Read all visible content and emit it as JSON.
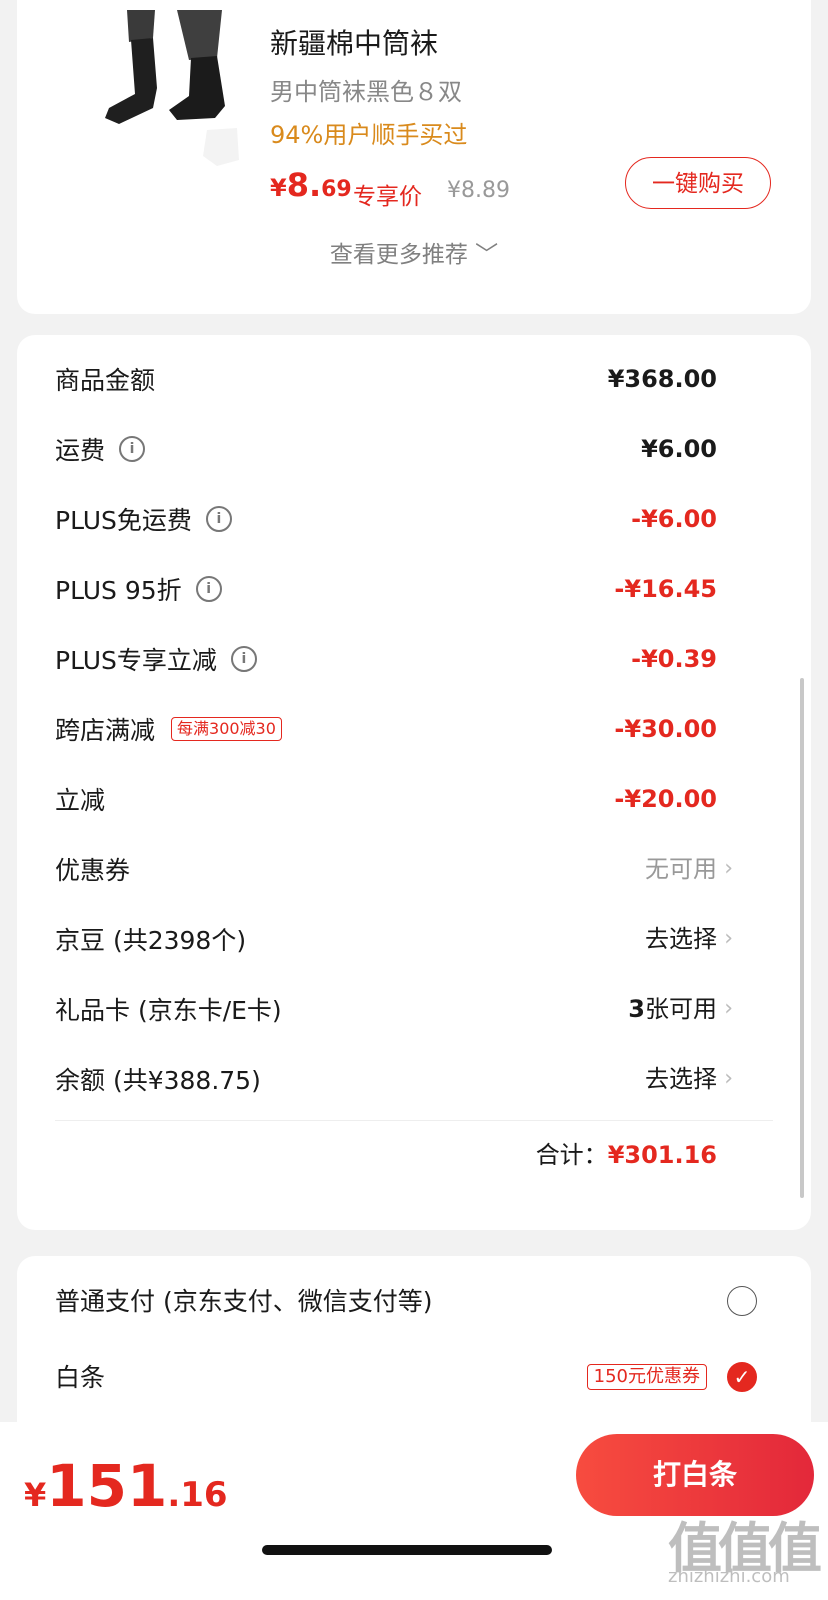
{
  "recommendation": {
    "product_name": "新疆棉中筒袜",
    "spec": "男中筒袜黑色８双",
    "hint": "94%用户顺手买过",
    "price_currency": "¥",
    "price_int": "8.",
    "price_dec": "69",
    "price_tag": "专享价",
    "original_price": "¥8.89",
    "buy_button": "一键购买",
    "more_label": "查看更多推荐 ﹀"
  },
  "costs": {
    "rows": [
      {
        "label": "商品金额",
        "value": "¥368.00"
      },
      {
        "label": "运费",
        "value": "¥6.00"
      },
      {
        "label": "PLUS免运费",
        "value": "-¥6.00"
      },
      {
        "label": "PLUS 95折",
        "value": "-¥16.45"
      },
      {
        "label": "PLUS专享立减",
        "value": "-¥0.39"
      },
      {
        "label": "跨店满减",
        "badge": "每满300减30",
        "value": "-¥30.00"
      },
      {
        "label": "立减",
        "value": "-¥20.00"
      },
      {
        "label": "优惠券",
        "value": "无可用"
      },
      {
        "label": "京豆 (共2398个)",
        "value": "去选择"
      },
      {
        "label": "礼品卡 (京东卡/E卡)",
        "value_num": "3",
        "value": "张可用"
      },
      {
        "label": "余额 (共¥388.75)",
        "value": "去选择"
      }
    ],
    "total_label": "合计：",
    "total_value": "¥301.16"
  },
  "payment": {
    "options": [
      {
        "label": "普通支付 (京东支付、微信支付等)",
        "selected": false
      },
      {
        "label": "白条",
        "badge": "150元优惠券",
        "selected": true
      }
    ]
  },
  "bottom": {
    "currency": "¥",
    "amount_int": "151",
    "amount_dec": ".16",
    "pay_button": "打白条"
  },
  "watermark": {
    "glyph": "值",
    "site": "zhizhizhi.com"
  },
  "colors": {
    "accent": "#e4281f",
    "hint": "#d98a1c"
  }
}
